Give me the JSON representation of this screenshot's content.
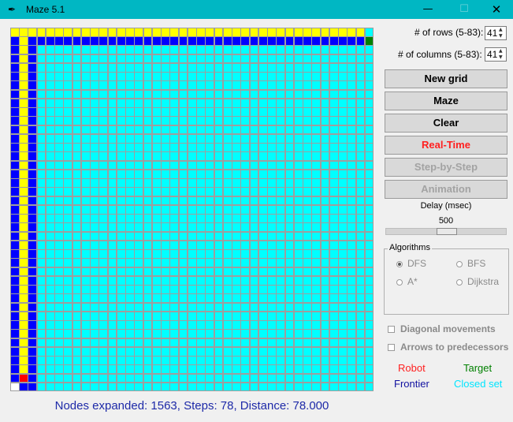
{
  "window": {
    "title": "Maze 5.1",
    "icon": "feather-icon",
    "minimize_glyph": "—",
    "maximize_glyph": "☐",
    "close_glyph": "✕"
  },
  "grid": {
    "rows": 41,
    "columns": 41,
    "colors": {
      "empty": "#00ffff",
      "closed": "#00ffff",
      "frontier": "#0000ff",
      "path": "#ffff00",
      "robot": "#ff0000",
      "target": "#008000",
      "obstacle": "#ffffff",
      "gridline": "#9e9e9e"
    },
    "path_row0_last_col": 39,
    "frontier_row1_last_col": 39,
    "robot_cell": [
      39,
      1
    ],
    "target_cell": [
      1,
      40
    ],
    "white_cell": [
      40,
      0
    ]
  },
  "status_text": "Nodes expanded: 1563, Steps: 78, Distance: 78.000",
  "controls": {
    "rows_label": "# of rows (5-83):",
    "rows_value": "41",
    "columns_label": "# of columns (5-83):",
    "columns_value": "41",
    "spinner_up": "▲",
    "spinner_down": "▼",
    "buttons": {
      "new_grid": "New grid",
      "maze": "Maze",
      "clear": "Clear",
      "real_time": "Real-Time",
      "step_by_step": "Step-by-Step",
      "animation": "Animation"
    },
    "delay_label": "Delay (msec)",
    "delay_value": "500",
    "delay_fraction": 0.5,
    "algorithms_label": "Algorithms",
    "algorithms": {
      "dfs": "DFS",
      "bfs": "BFS",
      "astar": "A*",
      "dijkstra": "Dijkstra",
      "selected": "DFS"
    },
    "diagonal_label": "Diagonal movements",
    "arrows_label": "Arrows to predecessors"
  },
  "legend": {
    "robot": "Robot",
    "target": "Target",
    "frontier": "Frontier",
    "closed_set": "Closed set",
    "robot_color": "#ff2020",
    "target_color": "#008000",
    "frontier_color": "#1010a0",
    "closed_color": "#00e5ff"
  }
}
